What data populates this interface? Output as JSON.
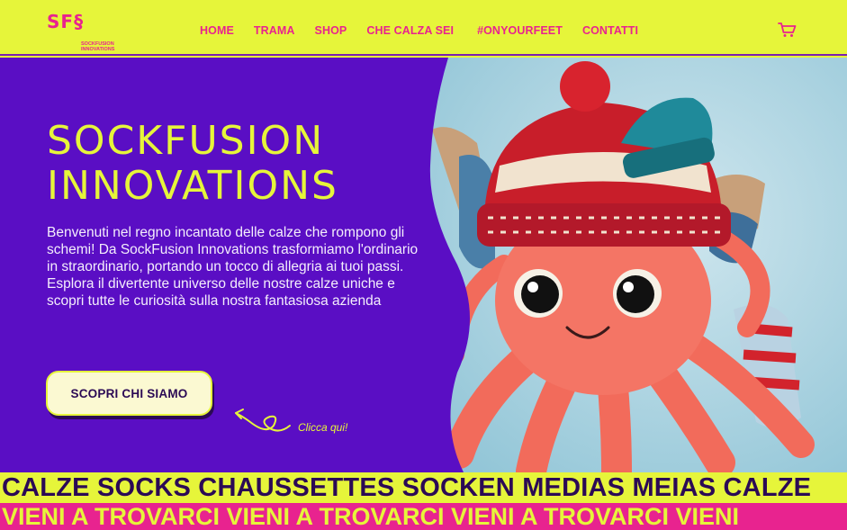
{
  "header": {
    "logo_mark": "SF§",
    "logo_sub": "SOCKFUSION INNOVATIONS",
    "nav": [
      "HOME",
      "TRAMA",
      "SHOP",
      "CHE CALZA SEI",
      "#ONYOURFEET",
      "CONTATTI"
    ],
    "cart_icon": "cart-icon"
  },
  "hero": {
    "title_line1": "SOCKFUSION",
    "title_line2": "INNOVATIONS",
    "intro_p1": "Benvenuti nel regno incantato delle calze che rompono gli schemi! Da SockFusion Innovations trasformiamo l'ordinario in straordinario, portando un tocco di allegria ai tuoi passi.",
    "intro_p2": "Esplora il divertente universo delle nostre calze uniche e scopri tutte le curiosità sulla nostra fantasiosa azienda",
    "cta_label": "SCOPRI CHI SIAMO",
    "click_hint": "Clicca qui!"
  },
  "bands": {
    "yellow_text": "CALZE SOCKS CHAUSSETTES SOCKEN MEDIAS MEIAS CALZE",
    "pink_text": "VIENI A TROVARCI VIENI A TROVARCI VIENI A TROVARCI VIENI"
  },
  "colors": {
    "lime": "#e6f53a",
    "pink": "#e8238f",
    "purple": "#5a0ec4",
    "dark": "#2b0a55"
  }
}
